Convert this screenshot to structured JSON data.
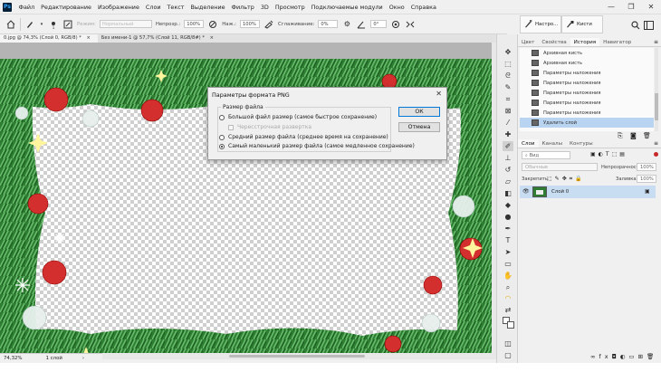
{
  "app": {
    "logo": "Ps"
  },
  "menu": [
    "Файл",
    "Редактирование",
    "Изображение",
    "Слои",
    "Текст",
    "Выделение",
    "Фильтр",
    "3D",
    "Просмотр",
    "Подключаемые модули",
    "Окно",
    "Справка"
  ],
  "window_controls": [
    "—",
    "❐",
    "✕"
  ],
  "options_bar": {
    "mode_label": "Режим:",
    "mode_value": "Нормальный",
    "opacity_label": "Непрозр.:",
    "opacity_value": "100%",
    "pressure_label": "Наж.:",
    "pressure_value": "100%",
    "smoothing_label": "Сглаживание:",
    "smoothing_value": "0%",
    "angle_value": "0°"
  },
  "tabs": [
    {
      "label": "0.jpg @ 74,3% (Слой 0, RGB/8) *",
      "close": "×",
      "active": true
    },
    {
      "label": "Без имени-1 @ 57,7% (Слой 11, RGB/8#) *",
      "close": "×",
      "active": false
    }
  ],
  "status": {
    "zoom": "74,32%",
    "info": "1 слой",
    "arrow": "›"
  },
  "mini_panels": [
    {
      "icon": "brush-settings-icon",
      "label": "Настро..."
    },
    {
      "icon": "brushes-icon",
      "label": "Кисти"
    }
  ],
  "history_tabs": [
    "Цвет",
    "Свойства",
    "История",
    "Навигатор"
  ],
  "history_active": "История",
  "history_items": [
    {
      "label": "Архивная кисть",
      "selected": false
    },
    {
      "label": "Архивная кисть",
      "selected": false
    },
    {
      "label": "Параметры наложения",
      "selected": false
    },
    {
      "label": "Параметры наложения",
      "selected": false
    },
    {
      "label": "Параметры наложения",
      "selected": false
    },
    {
      "label": "Параметры наложения",
      "selected": false
    },
    {
      "label": "Параметры наложения",
      "selected": false
    },
    {
      "label": "Удалить слой",
      "selected": true
    }
  ],
  "layers_tabs": [
    "Слои",
    "Каналы",
    "Контуры"
  ],
  "layers_active": "Слои",
  "layers": {
    "search_placeholder": "Вид",
    "blend_mode": "Обычные",
    "opacity_label": "Непрозрачность:",
    "opacity_value": "100%",
    "lock_label": "Закрепить:",
    "fill_label": "Заливка:",
    "fill_value": "100%",
    "layer_name": "Слой 0"
  },
  "dialog": {
    "title": "Параметры формата PNG",
    "close": "✕",
    "group_label": "Размер файла",
    "options": [
      {
        "type": "radio",
        "label": "Большой файл размер (самое быстрое сохранение)",
        "checked": false,
        "disabled": false
      },
      {
        "type": "checkbox",
        "label": "Чересстрочная развертка",
        "checked": false,
        "disabled": true
      },
      {
        "type": "radio",
        "label": "Средний размер файла (среднее время на сохранение)",
        "checked": false,
        "disabled": false
      },
      {
        "type": "radio",
        "label": "Самый маленький размер файла (самое медленное сохранение)",
        "checked": true,
        "disabled": false
      }
    ],
    "ok": "ОК",
    "cancel": "Отмена"
  },
  "colors": {
    "accent": "#0078d7",
    "history_selected": "#b8d4f0",
    "canvas_bg": "#b4b4b4"
  }
}
